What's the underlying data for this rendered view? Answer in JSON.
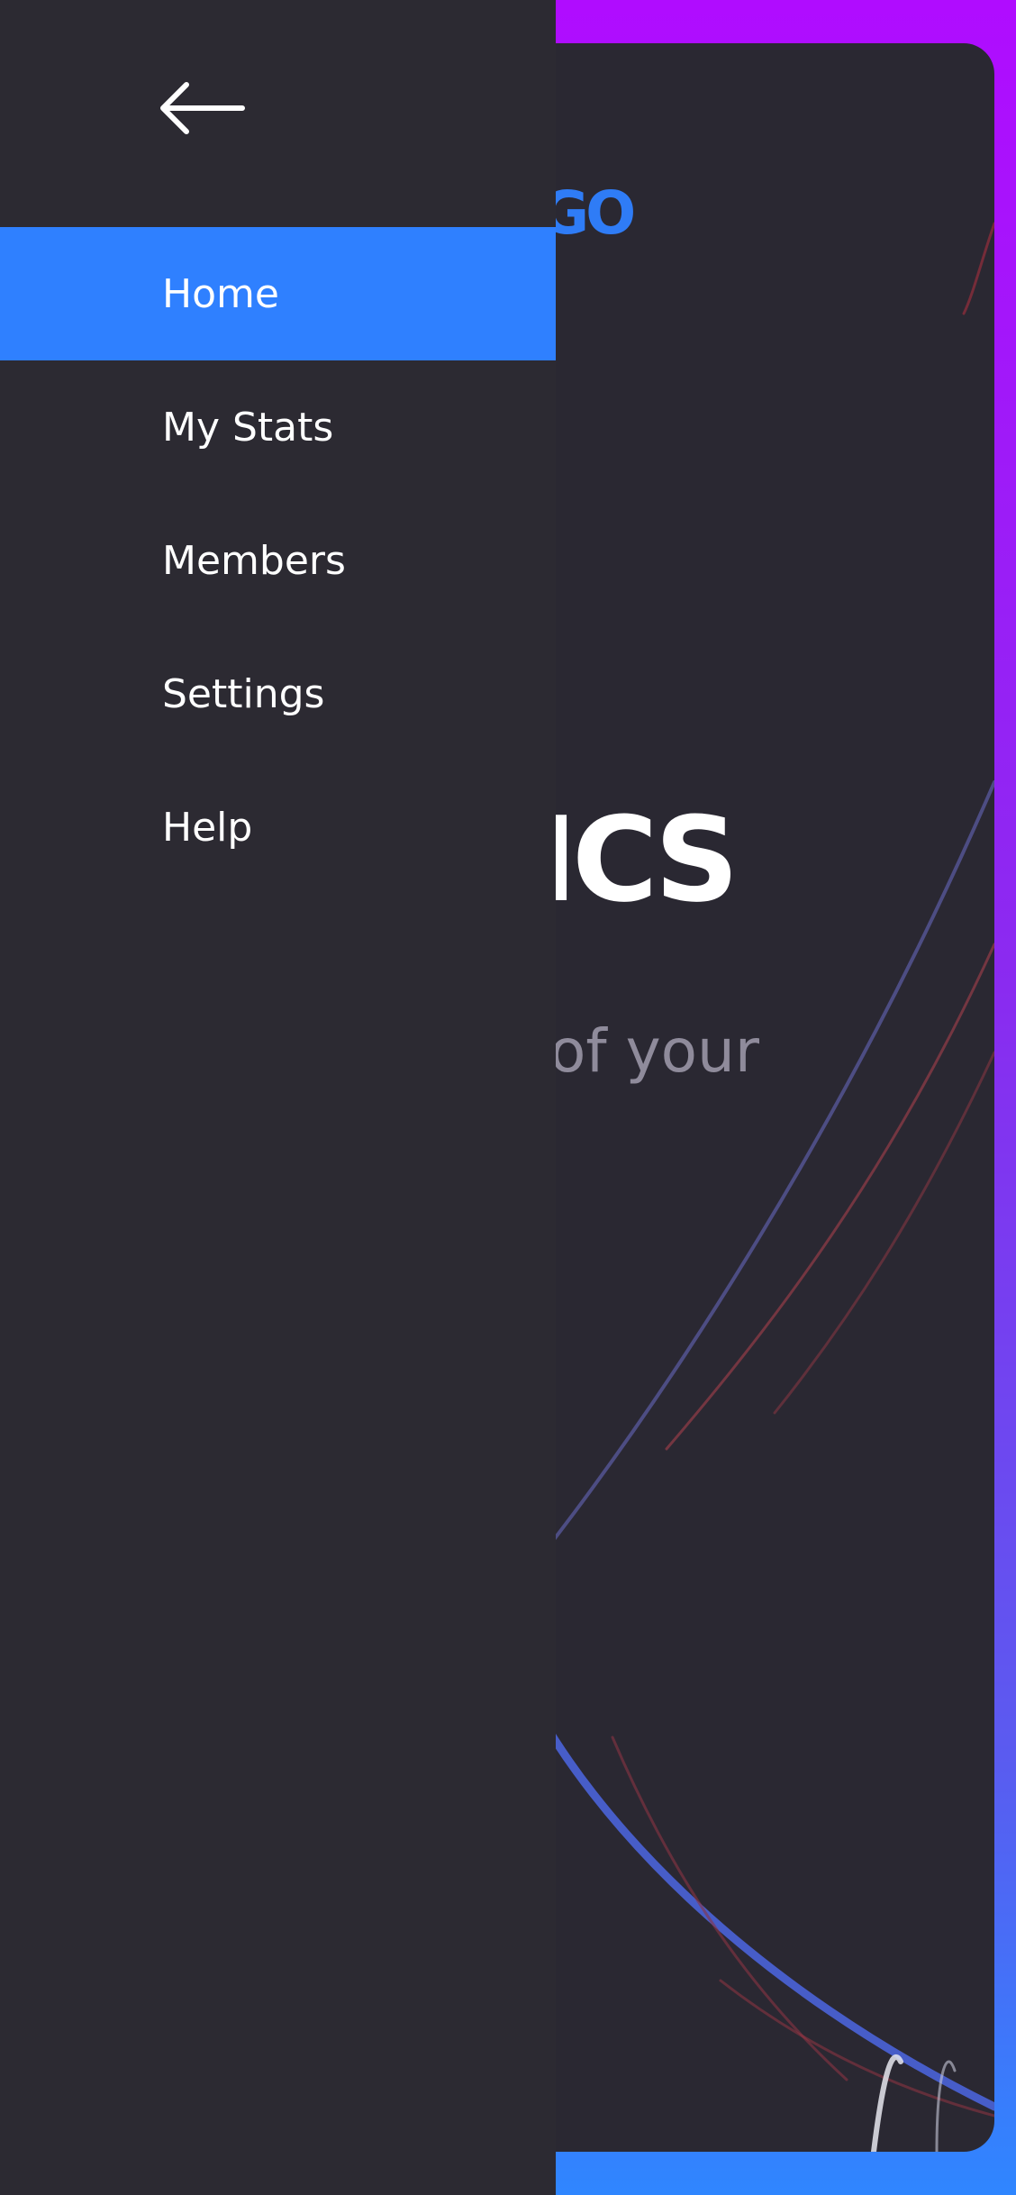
{
  "app": {
    "logo_partial": "GO",
    "hero_title_partial": "TICS",
    "hero_subtitle_partial": "of your"
  },
  "drawer": {
    "back_icon": "arrow-left-icon",
    "items": [
      {
        "label": "Home",
        "active": true
      },
      {
        "label": "My Stats",
        "active": false
      },
      {
        "label": "Members",
        "active": false
      },
      {
        "label": "Settings",
        "active": false
      },
      {
        "label": "Help",
        "active": false
      }
    ]
  },
  "colors": {
    "drawer_bg": "#2c2a32",
    "active_item": "#2f80ff",
    "frame_top": "#b00cff",
    "frame_bottom": "#2f86ff",
    "logo": "#2f7cf6"
  }
}
